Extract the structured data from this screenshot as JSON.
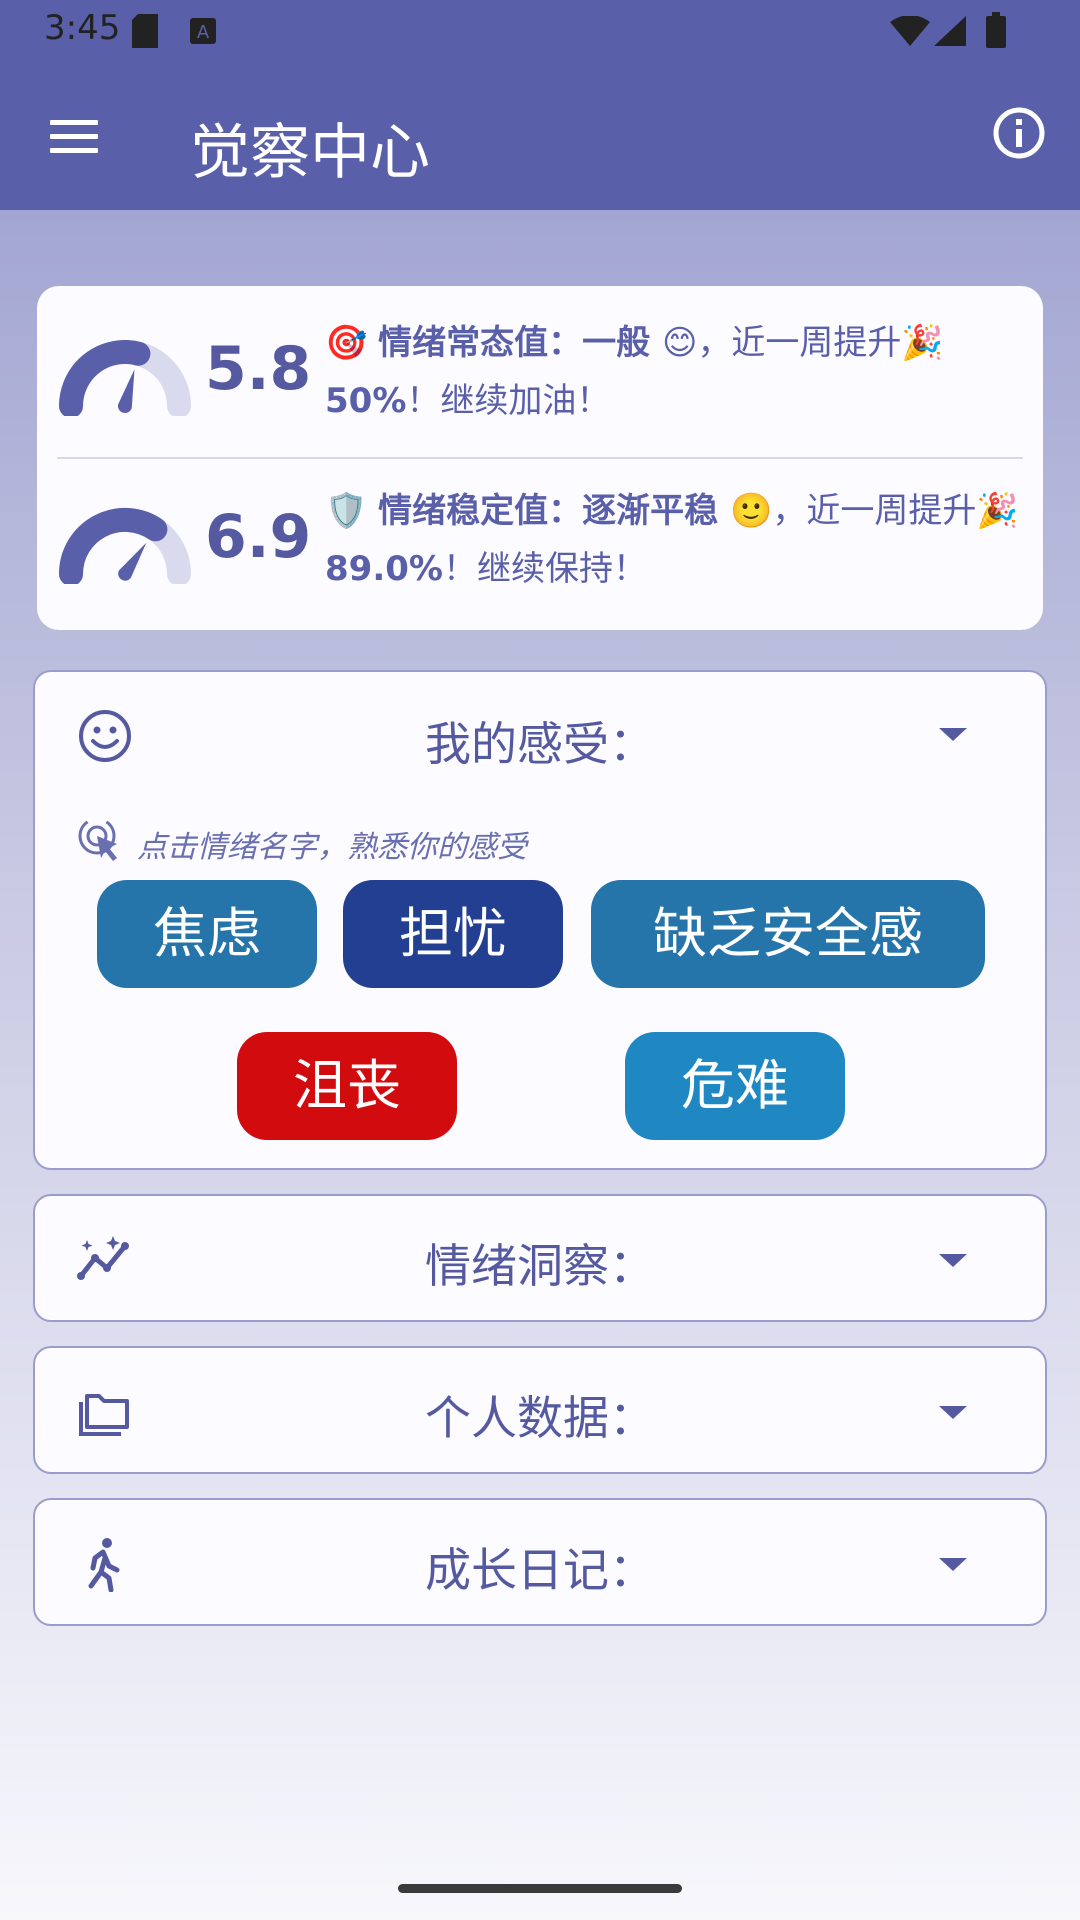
{
  "status": {
    "time": "3:45"
  },
  "app": {
    "title": "觉察中心"
  },
  "scores": [
    {
      "value": "5.8",
      "emoji": "🎯",
      "label": "情绪常态值：一般 😊",
      "rest": "，近一周提升🎉",
      "pct": "50%",
      "tail": "！继续加油！",
      "gauge_fraction": 0.58
    },
    {
      "value": "6.9",
      "emoji": "🛡️",
      "label": "情绪稳定值：逐渐平稳 🙂",
      "rest": "，近一周提升🎉",
      "pct": "89.0%",
      "tail": "！继续保持！",
      "gauge_fraction": 0.69
    }
  ],
  "feelings": {
    "title": "我的感受：",
    "hint": "点击情绪名字，熟悉你的感受",
    "chips": [
      {
        "label": "焦虑",
        "color": "#2574aa"
      },
      {
        "label": "担忧",
        "color": "#223f92"
      },
      {
        "label": "缺乏安全感",
        "color": "#2574aa"
      },
      {
        "label": "沮丧",
        "color": "#d20b0f"
      },
      {
        "label": "危难",
        "color": "#1f87c1"
      }
    ]
  },
  "sections": [
    {
      "title": "情绪洞察：",
      "icon": "insights-icon"
    },
    {
      "title": "个人数据：",
      "icon": "folder-icon"
    },
    {
      "title": "成长日记：",
      "icon": "walking-icon"
    }
  ],
  "colors": {
    "primary": "#5a5fa9",
    "surface": "#fcfbff"
  }
}
